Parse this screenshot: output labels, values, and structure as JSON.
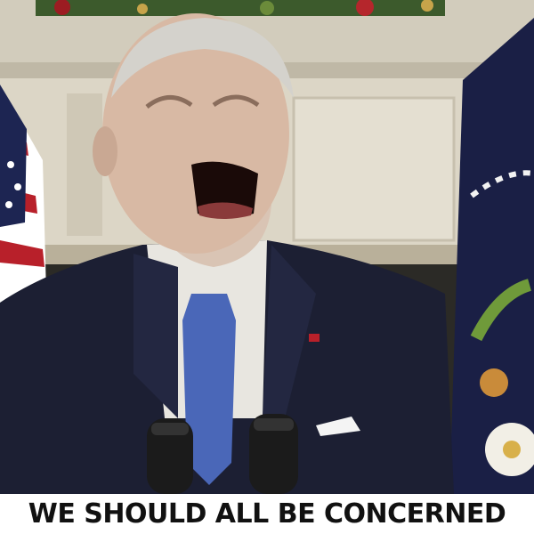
{
  "caption": {
    "text": "WE SHOULD ALL BE CONCERNED"
  },
  "scene": {
    "subject": "man-speaking-at-podium",
    "icons": [
      "american-flag-icon",
      "presidential-flag-icon",
      "microphone-icon",
      "microphone-icon",
      "flag-lapel-pin-icon"
    ]
  },
  "colors": {
    "caption_background": "#ffffff",
    "caption_text": "#111111",
    "suit": "#1c1f33",
    "tie": "#4a67b8",
    "shirt": "#e8e6e0",
    "mantel": "#dcd6c6",
    "flag_red": "#b8202a",
    "flag_blue": "#1d2552"
  }
}
